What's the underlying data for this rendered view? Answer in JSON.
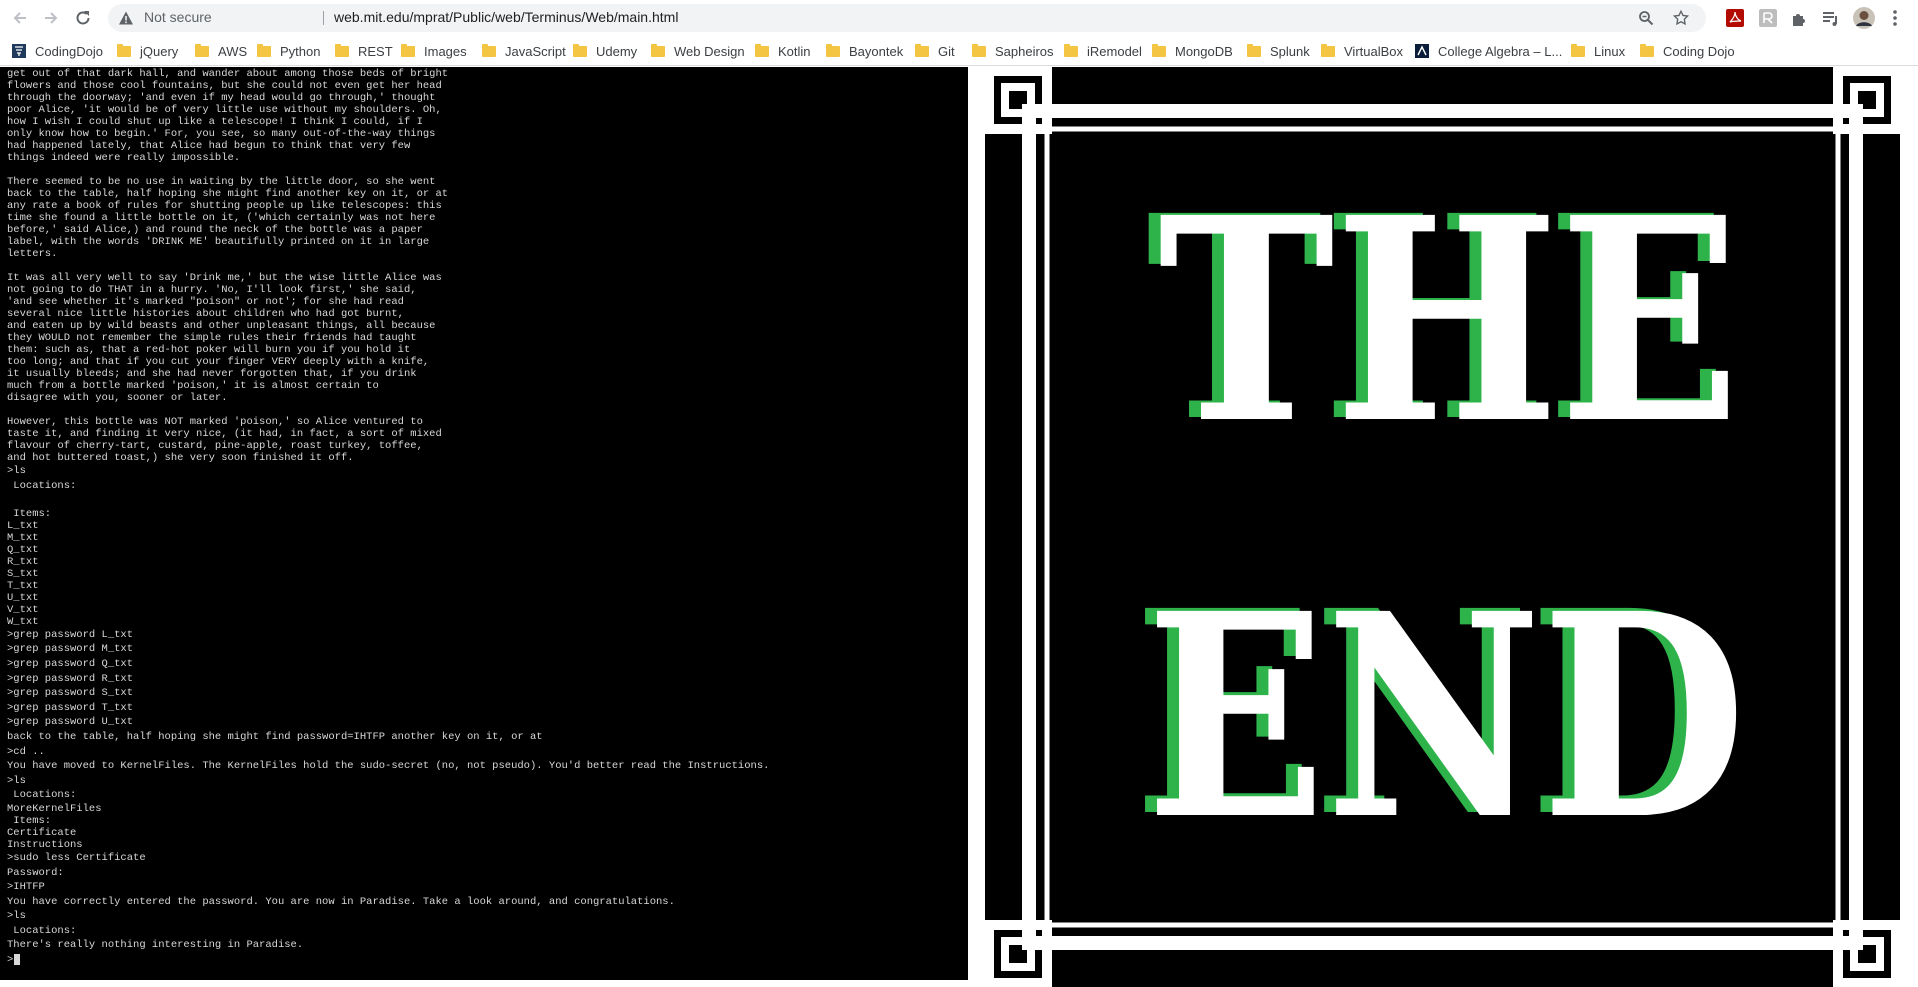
{
  "browser": {
    "security_label": "Not secure",
    "url": "web.mit.edu/mprat/Public/web/Terminus/Web/main.html",
    "bookmarks": [
      {
        "label": "CodingDojo",
        "icon": "codingdojo-icon"
      },
      {
        "label": "jQuery",
        "icon": "folder-icon"
      },
      {
        "label": "AWS",
        "icon": "folder-icon"
      },
      {
        "label": "Python",
        "icon": "folder-icon"
      },
      {
        "label": "REST",
        "icon": "folder-icon"
      },
      {
        "label": "Images",
        "icon": "folder-icon"
      },
      {
        "label": "JavaScript",
        "icon": "folder-icon"
      },
      {
        "label": "Udemy",
        "icon": "folder-icon"
      },
      {
        "label": "Web Design",
        "icon": "folder-icon"
      },
      {
        "label": "Kotlin",
        "icon": "folder-icon"
      },
      {
        "label": "Bayontek",
        "icon": "folder-icon"
      },
      {
        "label": "Git",
        "icon": "folder-icon"
      },
      {
        "label": "Sapheiros",
        "icon": "folder-icon"
      },
      {
        "label": "iRemodel",
        "icon": "folder-icon"
      },
      {
        "label": "MongoDB",
        "icon": "folder-icon"
      },
      {
        "label": "Splunk",
        "icon": "folder-icon"
      },
      {
        "label": "VirtualBox",
        "icon": "folder-icon"
      },
      {
        "label": "College Algebra – L...",
        "icon": "college-algebra-icon"
      },
      {
        "label": "Linux",
        "icon": "folder-icon"
      },
      {
        "label": "Coding Dojo",
        "icon": "folder-icon"
      }
    ]
  },
  "terminal": {
    "story_lines": [
      "get out of that dark hall, and wander about among those beds of bright",
      "flowers and those cool fountains, but she could not even get her head",
      "through the doorway; 'and even if my head would go through,' thought",
      "poor Alice, 'it would be of very little use without my shoulders. Oh,",
      "how I wish I could shut up like a telescope! I think I could, if I",
      "only know how to begin.' For, you see, so many out-of-the-way things",
      "had happened lately, that Alice had begun to think that very few",
      "things indeed were really impossible.",
      "",
      "There seemed to be no use in waiting by the little door, so she went",
      "back to the table, half hoping she might find another key on it, or at",
      "any rate a book of rules for shutting people up like telescopes: this",
      "time she found a little bottle on it, ('which certainly was not here",
      "before,' said Alice,) and round the neck of the bottle was a paper",
      "label, with the words 'DRINK ME' beautifully printed on it in large",
      "letters.",
      "",
      "It was all very well to say 'Drink me,' but the wise little Alice was",
      "not going to do THAT in a hurry. 'No, I'll look first,' she said,",
      "'and see whether it's marked \"poison\" or not'; for she had read",
      "several nice little histories about children who had got burnt,",
      "and eaten up by wild beasts and other unpleasant things, all because",
      "they WOULD not remember the simple rules their friends had taught",
      "them: such as, that a red-hot poker will burn you if you hold it",
      "too long; and that if you cut your finger VERY deeply with a knife,",
      "it usually bleeds; and she had never forgotten that, if you drink",
      "much from a bottle marked 'poison,' it is almost certain to",
      "disagree with you, sooner or later.",
      "",
      "However, this bottle was NOT marked 'poison,' so Alice ventured to",
      "taste it, and finding it very nice, (it had, in fact, a sort of mixed",
      "flavour of cherry-tart, custard, pine-apple, roast turkey, toffee,",
      "and hot buttered toast,) she very soon finished it off."
    ],
    "session_lines": [
      ">ls",
      " Locations:",
      "",
      " Items:",
      "L_txt",
      "M_txt",
      "Q_txt",
      "R_txt",
      "S_txt",
      "T_txt",
      "U_txt",
      "V_txt",
      "W_txt",
      ">grep password L_txt",
      ">grep password M_txt",
      ">grep password Q_txt",
      ">grep password R_txt",
      ">grep password S_txt",
      ">grep password T_txt",
      ">grep password U_txt",
      "back to the table, half hoping she might find password=IHTFP another key on it, or at",
      ">cd ..",
      "You have moved to KernelFiles. The KernelFiles hold the sudo-secret (no, not pseudo). You'd better read the Instructions.",
      ">ls",
      " Locations:",
      "MoreKernelFiles",
      " Items:",
      "Certificate",
      "Instructions",
      ">sudo less Certificate",
      "Password:",
      ">IHTFP",
      "You have correctly entered the password. You are now in Paradise. Take a look around, and congratulations.",
      ">ls",
      " Locations:",
      "There's really nothing interesting in Paradise."
    ],
    "prompt": ">"
  },
  "art": {
    "line1": "THE",
    "line2": "END",
    "letter_color": "#ffffff",
    "shadow_color": "#2db34a",
    "frame_color": "#ffffff",
    "background": "#000000"
  }
}
